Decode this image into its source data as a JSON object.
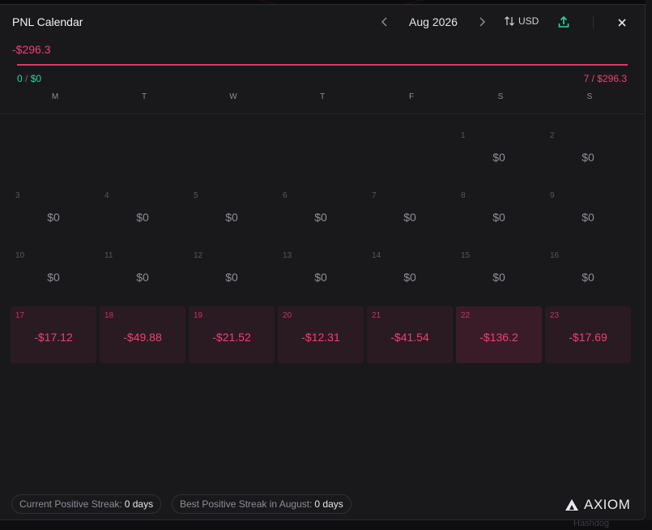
{
  "modal": {
    "title": "PNL Calendar",
    "month": "Aug 2026",
    "currency": "USD",
    "total_pnl": "-$296.3",
    "wins": {
      "count": "0",
      "sep": " / ",
      "amount": "$0"
    },
    "losses": {
      "count": "7",
      "sep": " / ",
      "amount": "$296.3"
    },
    "weekdays": [
      "M",
      "T",
      "W",
      "T",
      "F",
      "S",
      "S"
    ]
  },
  "calendar": {
    "leading_empty": 5,
    "days": [
      {
        "day": "1",
        "value": "$0",
        "type": "zero"
      },
      {
        "day": "2",
        "value": "$0",
        "type": "zero"
      },
      {
        "day": "3",
        "value": "$0",
        "type": "zero"
      },
      {
        "day": "4",
        "value": "$0",
        "type": "zero"
      },
      {
        "day": "5",
        "value": "$0",
        "type": "zero"
      },
      {
        "day": "6",
        "value": "$0",
        "type": "zero"
      },
      {
        "day": "7",
        "value": "$0",
        "type": "zero"
      },
      {
        "day": "8",
        "value": "$0",
        "type": "zero"
      },
      {
        "day": "9",
        "value": "$0",
        "type": "zero"
      },
      {
        "day": "10",
        "value": "$0",
        "type": "zero"
      },
      {
        "day": "11",
        "value": "$0",
        "type": "zero"
      },
      {
        "day": "12",
        "value": "$0",
        "type": "zero"
      },
      {
        "day": "13",
        "value": "$0",
        "type": "zero"
      },
      {
        "day": "14",
        "value": "$0",
        "type": "zero"
      },
      {
        "day": "15",
        "value": "$0",
        "type": "zero"
      },
      {
        "day": "16",
        "value": "$0",
        "type": "zero"
      },
      {
        "day": "17",
        "value": "-$17.12",
        "type": "loss"
      },
      {
        "day": "18",
        "value": "-$49.88",
        "type": "loss"
      },
      {
        "day": "19",
        "value": "-$21.52",
        "type": "loss"
      },
      {
        "day": "20",
        "value": "-$12.31",
        "type": "loss"
      },
      {
        "day": "21",
        "value": "-$41.54",
        "type": "loss"
      },
      {
        "day": "22",
        "value": "-$136.2",
        "type": "loss-big"
      },
      {
        "day": "23",
        "value": "-$17.69",
        "type": "loss"
      }
    ]
  },
  "footer": {
    "current_streak_label": "Current Positive Streak:",
    "current_streak_value": "0 days",
    "best_streak_label": "Best Positive Streak in August:",
    "best_streak_value": "0 days",
    "brand": "AXIOM"
  },
  "backdrop": {
    "label": "Hashdog"
  },
  "colors": {
    "loss": "#f0406f",
    "win": "#2fd39a",
    "panel": "#19191c"
  },
  "icons": {
    "prev": "chevron-left-icon",
    "next": "chevron-right-icon",
    "currency": "sort-arrows-icon",
    "share": "upload-icon",
    "close": "close-icon",
    "brand": "axiom-logo-icon"
  }
}
